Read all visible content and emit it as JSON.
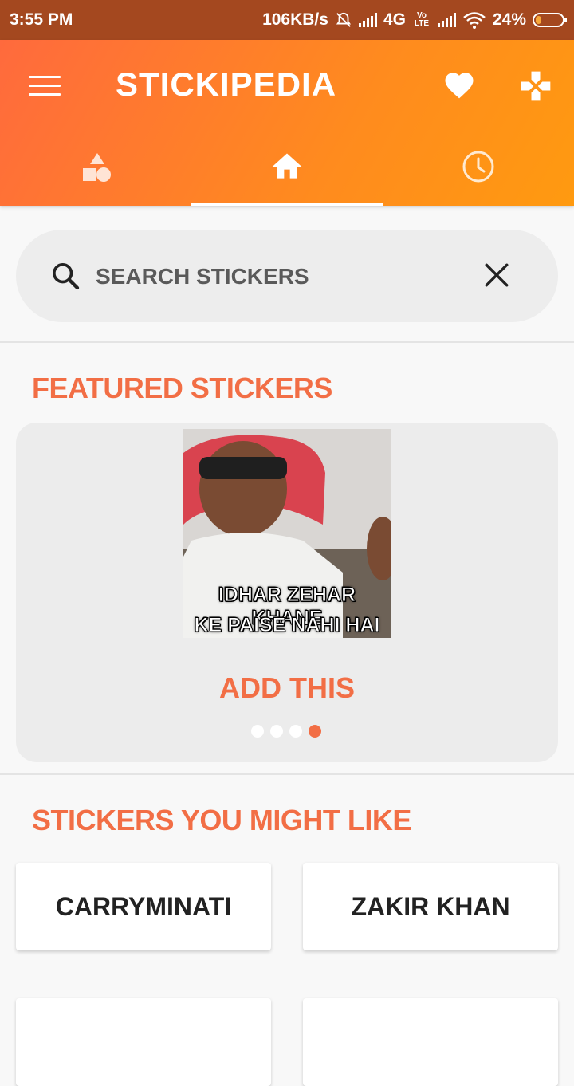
{
  "status_bar": {
    "time": "3:55 PM",
    "speed": "106KB/s",
    "network": "4G",
    "volte": "Vo LTE",
    "battery": "24%"
  },
  "app_bar": {
    "title": "STICKIPEDIA",
    "icons": [
      "menu-icon",
      "heart-icon",
      "gamepad-icon"
    ]
  },
  "tabs": [
    {
      "icon": "shapes-icon",
      "active": false
    },
    {
      "icon": "home-icon",
      "active": true
    },
    {
      "icon": "clock-icon",
      "active": false
    }
  ],
  "search": {
    "placeholder": "SEARCH STICKERS",
    "value": ""
  },
  "featured": {
    "title": "FEATURED STICKERS",
    "sticker_caption_line1": "IDHAR ZEHAR KHANE",
    "sticker_caption_line2": "KE PAISE NAHI HAI",
    "add_label": "ADD THIS",
    "page_count": 4,
    "active_page": 4
  },
  "suggested": {
    "title": "STICKERS YOU MIGHT LIKE",
    "items": [
      "CARRYMINATI",
      "ZAKIR KHAN",
      "",
      ""
    ]
  },
  "colors": {
    "accent": "#f26e45",
    "gradient_start": "#ff6a3d",
    "gradient_end": "#ff9a10",
    "status_bar": "#a4481f"
  }
}
